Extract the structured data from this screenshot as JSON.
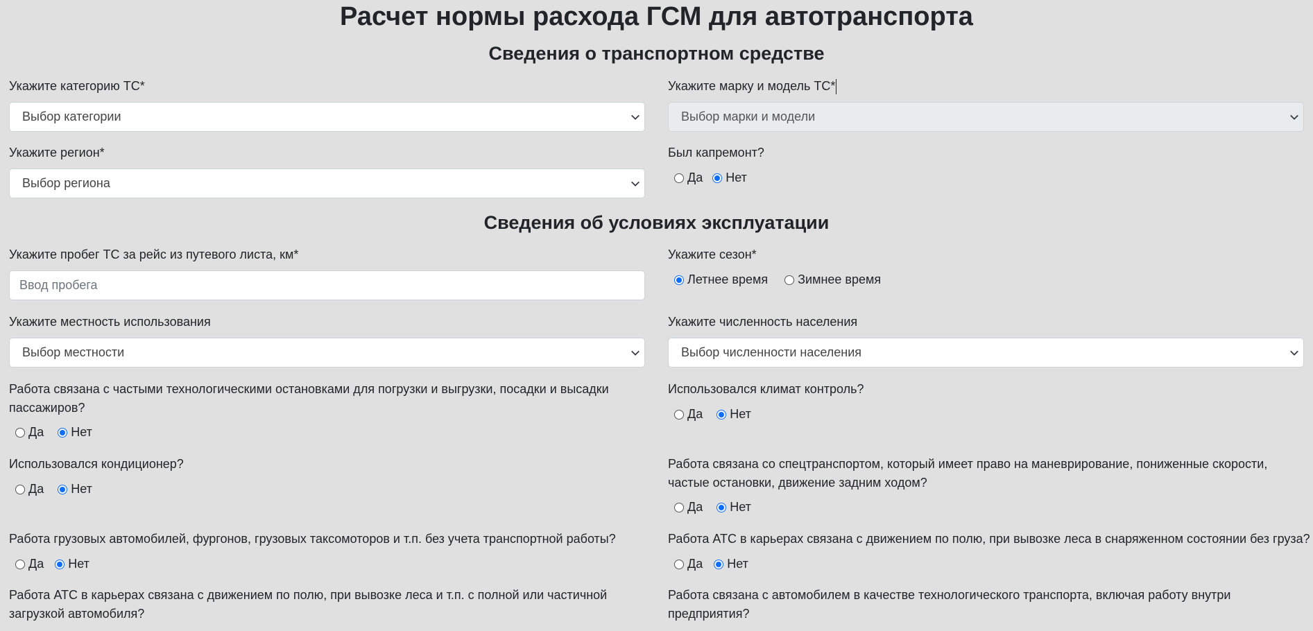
{
  "title": "Расчет нормы расхода ГСМ для автотранспорта",
  "section_vehicle": "Сведения о транспортном средстве",
  "section_conditions": "Сведения об условиях эксплуатации",
  "fields": {
    "category": {
      "label": "Укажите категорию ТС*",
      "value": "Выбор категории"
    },
    "brand": {
      "label": "Укажите марку и модель ТС*",
      "value": "Выбор марки и модели"
    },
    "region": {
      "label": "Укажите регион*",
      "value": "Выбор региона"
    },
    "overhaul": {
      "label": "Был капремонт?",
      "yes": "Да",
      "no": "Нет",
      "selected": "no"
    },
    "mileage": {
      "label": "Укажите пробег ТС за рейс из путевого листа, км*",
      "placeholder": "Ввод пробега"
    },
    "season": {
      "label": "Укажите сезон*",
      "summer": "Летнее время",
      "winter": "Зимнее время",
      "selected": "summer"
    },
    "terrain": {
      "label": "Укажите местность использования",
      "value": "Выбор местности"
    },
    "population": {
      "label": "Укажите численность населения",
      "value": "Выбор численности населения"
    },
    "stops": {
      "label": "Работа связана с частыми технологическими остановками для погрузки и выгрузки, посадки и высадки пассажиров?",
      "yes": "Да",
      "no": "Нет",
      "selected": "no"
    },
    "climate": {
      "label": "Использовался климат контроль?",
      "yes": "Да",
      "no": "Нет",
      "selected": "no"
    },
    "aircon": {
      "label": "Использовался кондиционер?",
      "yes": "Да",
      "no": "Нет",
      "selected": "no"
    },
    "special": {
      "label": "Работа связана со спецтранспортом, который имеет право на маневрирование, пониженные скорости, частые остановки, движение задним ходом?",
      "yes": "Да",
      "no": "Нет",
      "selected": "no"
    },
    "trucks": {
      "label": "Работа грузовых автомобилей, фургонов, грузовых таксомоторов и т.п. без учета транспортной работы?",
      "yes": "Да",
      "no": "Нет",
      "selected": "no"
    },
    "quarry_empty": {
      "label": "Работа АТС в карьерах связана с движением по полю, при вывозке леса в снаряженном состоянии без груза?",
      "yes": "Да",
      "no": "Нет",
      "selected": "no"
    },
    "quarry_loaded": {
      "label": "Работа АТС в карьерах связана с движением по полю, при вывозке леса и т.п. с полной или частичной загрузкой автомобиля?"
    },
    "tech_transport": {
      "label": "Работа связана с автомобилем в качестве технологического транспорта, включая работу внутри предприятия?"
    }
  }
}
